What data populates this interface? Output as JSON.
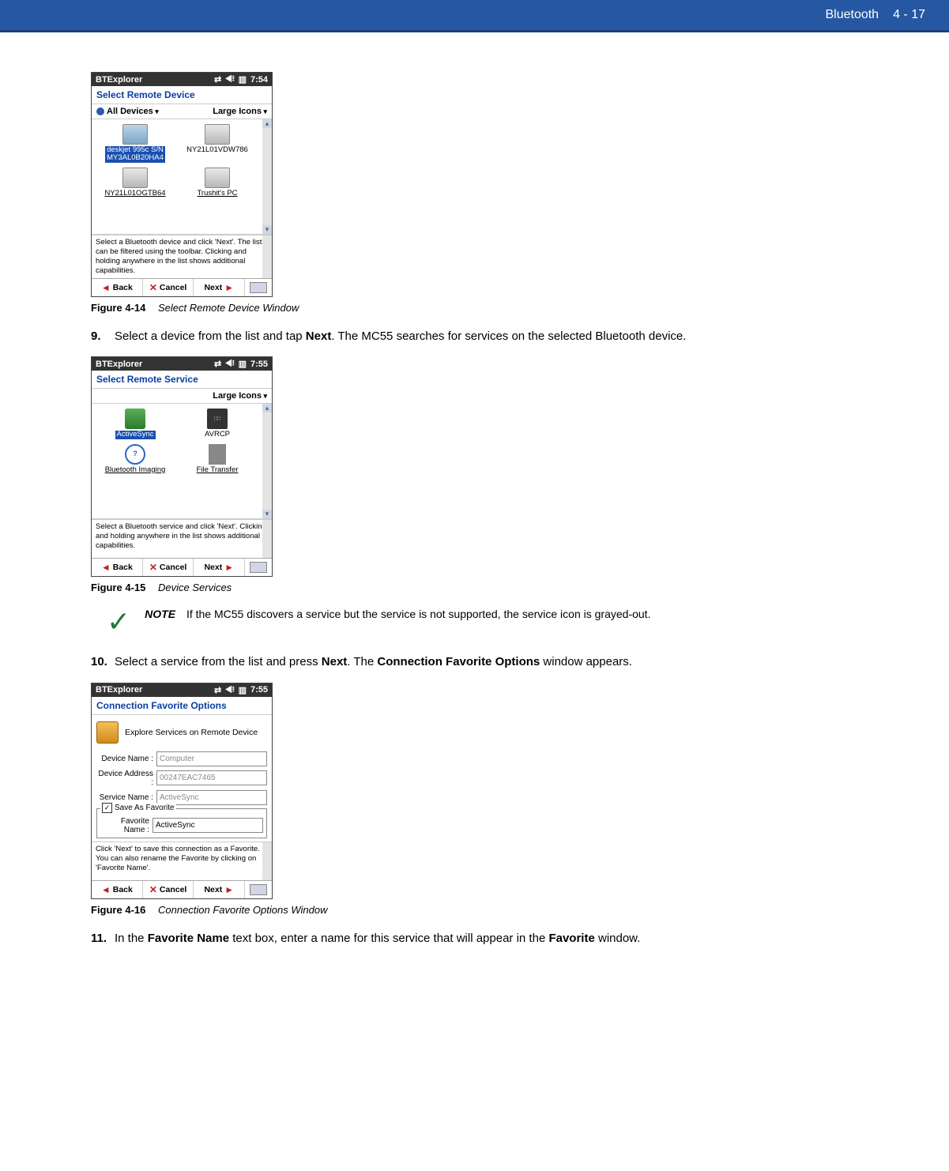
{
  "header": {
    "section": "Bluetooth",
    "page": "4 - 17"
  },
  "fig1": {
    "titlebar": "BTExplorer",
    "time": "7:54",
    "subtitle": "Select Remote Device",
    "toolbar_left": "All Devices",
    "toolbar_right": "Large Icons",
    "devices": {
      "d1a": "deskjet 995c S/N",
      "d1b": "MY3AL0B20HA4",
      "d2": "NY21L01VDW786",
      "d3": "NY21L01OGTB64",
      "d4": "Trushit's PC"
    },
    "hint": "Select a Bluetooth device and click 'Next'. The list can be filtered using the toolbar. Clicking and holding anywhere in the list shows additional capabilities.",
    "back": "Back",
    "cancel": "Cancel",
    "next": "Next",
    "caption_label": "Figure 4-14",
    "caption_title": "Select Remote Device Window"
  },
  "step9": {
    "num": "9.",
    "textA": "Select a device from the list and tap ",
    "bold1": "Next",
    "textB": ". The MC55 searches for services on the selected Bluetooth device."
  },
  "fig2": {
    "titlebar": "BTExplorer",
    "time": "7:55",
    "subtitle": "Select Remote Service",
    "toolbar_right": "Large Icons",
    "services": {
      "s1": "ActiveSync",
      "s2": "AVRCP",
      "s3": "Bluetooth Imaging",
      "s4": "File Transfer"
    },
    "hint": "Select a Bluetooth service and click 'Next'. Clicking and holding anywhere in the list shows additional capabilities.",
    "back": "Back",
    "cancel": "Cancel",
    "next": "Next",
    "caption_label": "Figure 4-15",
    "caption_title": "Device Services"
  },
  "note": {
    "label": "NOTE",
    "text": "If the MC55 discovers a service but the service is not supported, the service icon is grayed-out."
  },
  "step10": {
    "num": "10.",
    "textA": "Select a service from the list and press ",
    "bold1": "Next",
    "textB": ". The ",
    "bold2": "Connection Favorite Options",
    "textC": " window appears."
  },
  "fig3": {
    "titlebar": "BTExplorer",
    "time": "7:55",
    "subtitle": "Connection Favorite Options",
    "explore": "Explore Services on Remote Device",
    "labels": {
      "device_name": "Device Name :",
      "device_address": "Device Address :",
      "service_name": "Service Name :",
      "save_as_fav": "Save As Favorite",
      "fav_name": "Favorite Name :"
    },
    "values": {
      "device_name": "Computer",
      "device_address": "00247EAC7465",
      "service_name": "ActiveSync",
      "fav_name": "ActiveSync"
    },
    "hint": "Click 'Next' to save this connection as a Favorite.  You can also rename the Favorite by clicking on 'Favorite Name'.",
    "back": "Back",
    "cancel": "Cancel",
    "next": "Next",
    "caption_label": "Figure 4-16",
    "caption_title": "Connection Favorite Options Window"
  },
  "step11": {
    "num": "11.",
    "textA": "In the ",
    "bold1": "Favorite Name",
    "textB": " text box, enter a name for this service that will appear in the ",
    "bold2": "Favorite",
    "textC": " window."
  }
}
